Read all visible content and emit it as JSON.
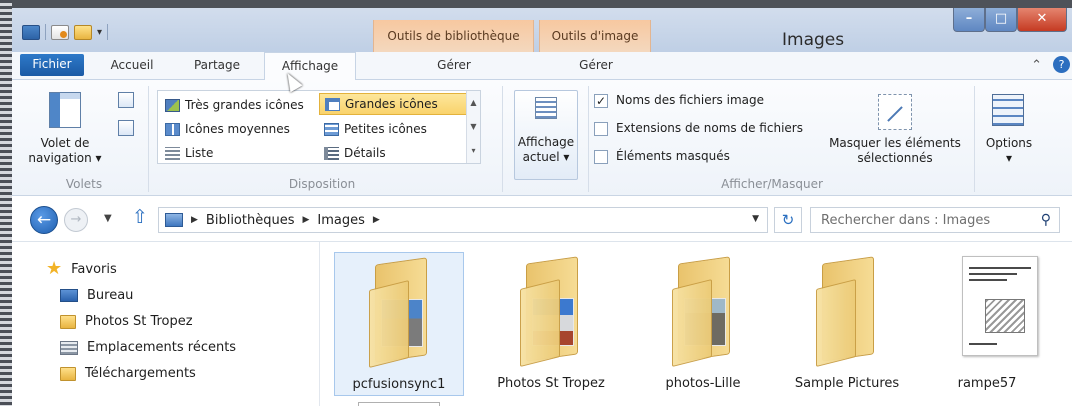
{
  "window": {
    "title": "Images"
  },
  "context_tabs": [
    {
      "label": "Outils de bibliothèque",
      "sub": "Gérer"
    },
    {
      "label": "Outils d'image",
      "sub": "Gérer"
    }
  ],
  "tabs": {
    "file": "Fichier",
    "home": "Accueil",
    "share": "Partage",
    "view": "Affichage"
  },
  "ribbon": {
    "panes": {
      "nav_line1": "Volet de",
      "nav_line2": "navigation ▾",
      "group": "Volets"
    },
    "layout": {
      "group": "Disposition",
      "items": [
        "Très grandes icônes",
        "Grandes icônes",
        "Icônes moyennes",
        "Petites icônes",
        "Liste",
        "Détails"
      ],
      "selected": "Grandes icônes"
    },
    "current_view": {
      "line1": "Affichage",
      "line2": "actuel ▾"
    },
    "show_hide": {
      "group": "Afficher/Masquer",
      "options": [
        {
          "label": "Noms des fichiers image",
          "checked": true
        },
        {
          "label": "Extensions de noms de fichiers",
          "checked": false
        },
        {
          "label": "Éléments masqués",
          "checked": false
        }
      ],
      "hide_line1": "Masquer les éléments",
      "hide_line2": "sélectionnés"
    },
    "options": {
      "label": "Options",
      "arrow": "▾"
    }
  },
  "address": {
    "crumbs": [
      "Bibliothèques",
      "Images"
    ],
    "search_placeholder": "Rechercher dans : Images"
  },
  "sidebar": {
    "favorites": "Favoris",
    "items": [
      "Bureau",
      "Photos St Tropez",
      "Emplacements récents",
      "Téléchargements"
    ]
  },
  "files": [
    {
      "name": "pcfusionsync1",
      "kind": "folder",
      "selected": true
    },
    {
      "name": "Photos St Tropez",
      "kind": "folder",
      "selected": false
    },
    {
      "name": "photos-Lille",
      "kind": "folder",
      "selected": false
    },
    {
      "name": "Sample Pictures",
      "kind": "folder",
      "selected": false
    },
    {
      "name": "rampe57",
      "kind": "document",
      "selected": false
    }
  ]
}
